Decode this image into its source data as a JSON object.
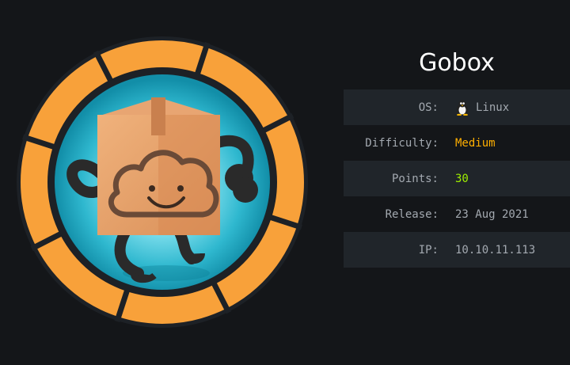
{
  "machine": {
    "name": "Gobox",
    "rows": [
      {
        "label": "OS:",
        "value": "Linux",
        "icon": "linux-penguin-icon"
      },
      {
        "label": "Difficulty:",
        "value": "Medium"
      },
      {
        "label": "Points:",
        "value": "30"
      },
      {
        "label": "Release:",
        "value": "23 Aug 2021"
      },
      {
        "label": "IP:",
        "value": "10.10.11.113"
      }
    ]
  },
  "colors": {
    "background": "#141619",
    "ring": "#f8a13a",
    "difficulty_medium": "#ffaf00",
    "points": "#9fef00",
    "row_shade": "#20252a"
  },
  "badge": {
    "logo": "cardboard-box-mascot-icon"
  }
}
